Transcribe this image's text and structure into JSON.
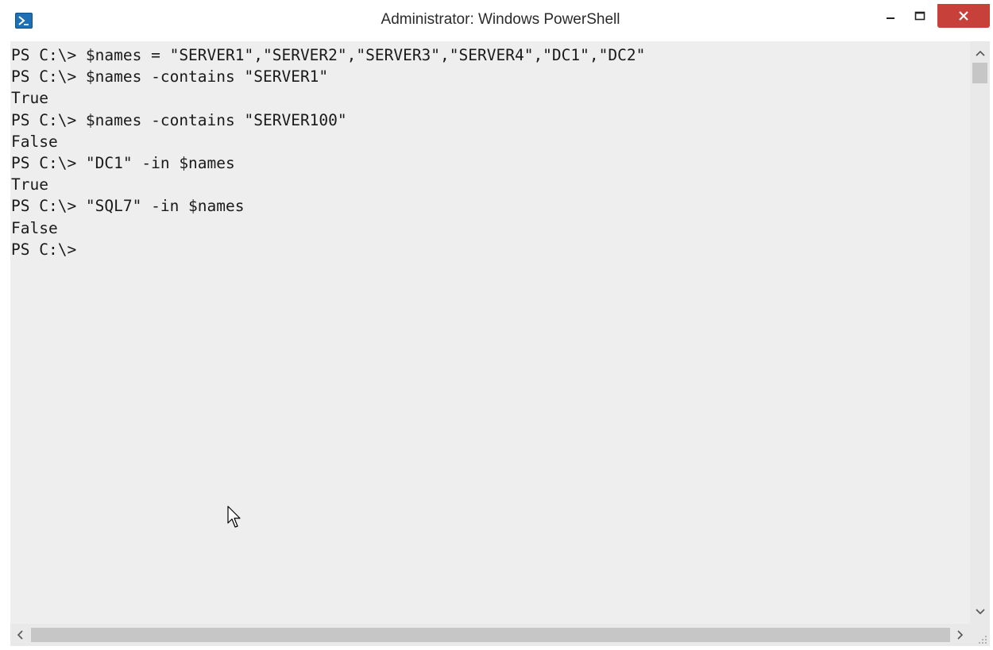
{
  "window": {
    "title": "Administrator: Windows PowerShell",
    "icon": "powershell-icon",
    "controls": {
      "minimize_icon": "minimize-icon",
      "maximize_icon": "maximize-icon",
      "close_icon": "close-icon",
      "close_color": "#c7413a"
    }
  },
  "console": {
    "background": "#eeeeee",
    "lines": [
      "PS C:\\> $names = \"SERVER1\",\"SERVER2\",\"SERVER3\",\"SERVER4\",\"DC1\",\"DC2\"",
      "PS C:\\> $names -contains \"SERVER1\"",
      "True",
      "PS C:\\> $names -contains \"SERVER100\"",
      "False",
      "PS C:\\> \"DC1\" -in $names",
      "True",
      "PS C:\\> \"SQL7\" -in $names",
      "False",
      "PS C:\\>"
    ]
  },
  "scrollbars": {
    "vertical": {
      "up_icon": "chevron-up-icon",
      "down_icon": "chevron-down-icon"
    },
    "horizontal": {
      "left_icon": "chevron-left-icon",
      "right_icon": "chevron-right-icon"
    }
  },
  "cursor_icon": "mouse-pointer-icon"
}
